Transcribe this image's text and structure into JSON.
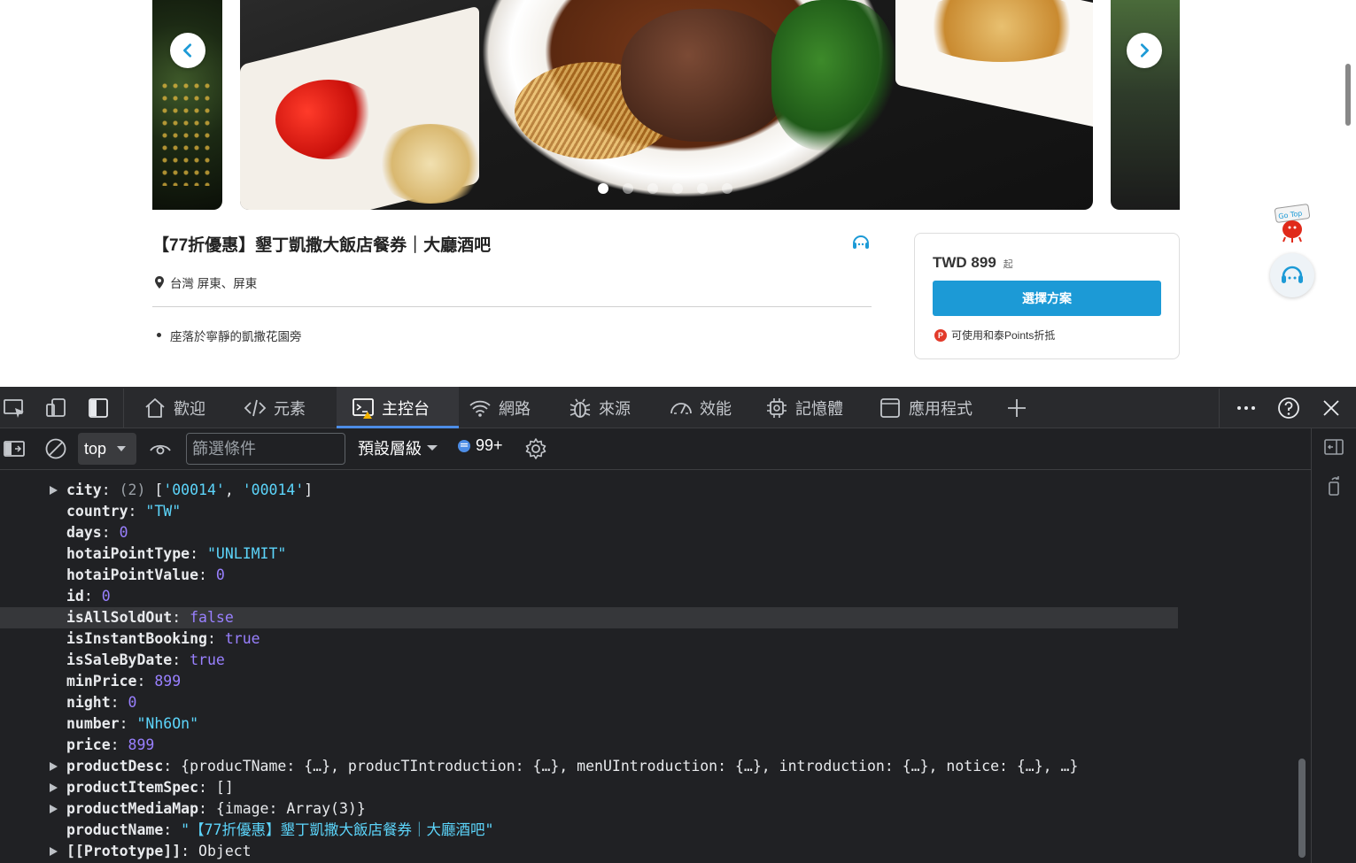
{
  "page": {
    "product_title": "【77折優惠】墾丁凱撒大飯店餐券｜大廳酒吧",
    "location": "台灣 屏東、屏東",
    "bullet": "座落於寧靜的凱撒花園旁",
    "price": "TWD 899",
    "price_suffix": "起",
    "choose_button": "選擇方案",
    "points_icon": "P",
    "points_text": "可使用和泰Points折抵",
    "gotop_text": "Go Top",
    "carousel": {
      "slide_count": 6,
      "active_index": 0
    },
    "brand_color": "#1c9ad6"
  },
  "devtools": {
    "tabs": [
      {
        "label": "歡迎",
        "icon": "home-icon"
      },
      {
        "label": "元素",
        "icon": "code-icon"
      },
      {
        "label": "主控台",
        "icon": "console-icon"
      },
      {
        "label": "網路",
        "icon": "wifi-icon"
      },
      {
        "label": "來源",
        "icon": "bug-icon"
      },
      {
        "label": "效能",
        "icon": "gauge-icon"
      },
      {
        "label": "記憶體",
        "icon": "chip-icon"
      },
      {
        "label": "應用程式",
        "icon": "window-icon"
      }
    ],
    "active_tab": "主控台",
    "toolbar": {
      "context": "top",
      "filter_placeholder": "篩選條件",
      "level": "預設層級",
      "issues": "99+"
    },
    "console_lines": [
      {
        "expand": true,
        "key": "city",
        "parts": [
          [
            "g",
            "(2) "
          ],
          [
            "p",
            "["
          ],
          [
            "s",
            "'00014'"
          ],
          [
            "p",
            ", "
          ],
          [
            "s",
            "'00014'"
          ],
          [
            "p",
            "]"
          ]
        ]
      },
      {
        "expand": false,
        "key": "country",
        "parts": [
          [
            "s",
            "\"TW\""
          ]
        ]
      },
      {
        "expand": false,
        "key": "days",
        "parts": [
          [
            "n",
            "0"
          ]
        ]
      },
      {
        "expand": false,
        "key": "hotaiPointType",
        "parts": [
          [
            "s",
            "\"UNLIMIT\""
          ]
        ]
      },
      {
        "expand": false,
        "key": "hotaiPointValue",
        "parts": [
          [
            "n",
            "0"
          ]
        ]
      },
      {
        "expand": false,
        "key": "id",
        "parts": [
          [
            "n",
            "0"
          ]
        ]
      },
      {
        "expand": false,
        "key": "isAllSoldOut",
        "parts": [
          [
            "n",
            "false"
          ]
        ],
        "highlight": true
      },
      {
        "expand": false,
        "key": "isInstantBooking",
        "parts": [
          [
            "n",
            "true"
          ]
        ]
      },
      {
        "expand": false,
        "key": "isSaleByDate",
        "parts": [
          [
            "n",
            "true"
          ]
        ]
      },
      {
        "expand": false,
        "key": "minPrice",
        "parts": [
          [
            "n",
            "899"
          ]
        ]
      },
      {
        "expand": false,
        "key": "night",
        "parts": [
          [
            "n",
            "0"
          ]
        ]
      },
      {
        "expand": false,
        "key": "number",
        "parts": [
          [
            "s",
            "\"Nh6On\""
          ]
        ]
      },
      {
        "expand": false,
        "key": "price",
        "parts": [
          [
            "n",
            "899"
          ]
        ]
      },
      {
        "expand": true,
        "key": "productDesc",
        "parts": [
          [
            "p",
            "{producTName: {…}, producTIntroduction: {…}, menUIntroduction: {…}, introduction: {…}, notice: {…}, …}"
          ]
        ]
      },
      {
        "expand": true,
        "key": "productItemSpec",
        "parts": [
          [
            "p",
            "[]"
          ]
        ]
      },
      {
        "expand": true,
        "key": "productMediaMap",
        "parts": [
          [
            "p",
            "{image: Array(3)}"
          ]
        ]
      },
      {
        "expand": false,
        "key": "productName",
        "parts": [
          [
            "s",
            "\"【77折優惠】墾丁凱撒大飯店餐券｜大廳酒吧\""
          ]
        ]
      },
      {
        "expand": true,
        "key": "[[Prototype]]",
        "parts": [
          [
            "p",
            "Object"
          ]
        ]
      }
    ]
  }
}
